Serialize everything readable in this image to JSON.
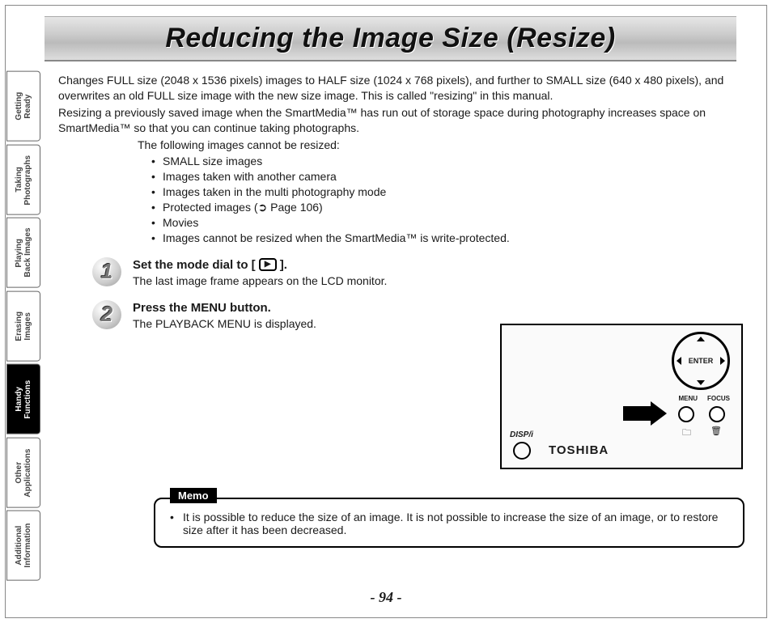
{
  "page": {
    "title": "Reducing the Image Size (Resize)",
    "number": "- 94 -"
  },
  "sidebar": {
    "items": [
      {
        "label": "Getting\nReady",
        "active": false
      },
      {
        "label": "Taking\nPhotographs",
        "active": false
      },
      {
        "label": "Playing\nBack Images",
        "active": false
      },
      {
        "label": "Erasing\nImages",
        "active": false
      },
      {
        "label": "Handy\nFunctions",
        "active": true
      },
      {
        "label": "Other\nApplications",
        "active": false
      },
      {
        "label": "Additional\nInformation",
        "active": false
      }
    ]
  },
  "intro": {
    "p1": "Changes FULL size (2048 x 1536 pixels) images to HALF size (1024 x 768 pixels), and further to SMALL size (640 x 480 pixels), and overwrites an old FULL size image with the new size image. This is called \"resizing\" in this manual.",
    "p2": "Resizing a previously saved image when the SmartMedia™ has run out of storage space during photography increases space on SmartMedia™ so that you can continue taking photographs.",
    "cannot_line": "The following images cannot be resized:",
    "bullets": [
      "SMALL size images",
      "Images taken with another camera",
      "Images taken in the multi photography mode",
      "Protected images (➲ Page 106)",
      "Movies",
      "Images cannot be resized when the SmartMedia™ is write-protected."
    ]
  },
  "steps": [
    {
      "num": "1",
      "title_pre": "Set the mode dial to [",
      "title_post": "].",
      "play_glyph": "▶",
      "sub": "The last image frame appears on the LCD monitor."
    },
    {
      "num": "2",
      "title": "Press the MENU button.",
      "sub": "The PLAYBACK MENU is displayed."
    }
  ],
  "camera": {
    "enter": "ENTER",
    "menu": "MENU",
    "focus": "FOCUS",
    "disp": "DISP/i",
    "brand": "TOSHIBA",
    "folder_glyph": "🗀",
    "trash_glyph": "🗑"
  },
  "memo": {
    "tag": "Memo",
    "items": [
      "It is possible to reduce the size of an image. It is not possible to increase the size of an image, or to restore size after it has been decreased."
    ]
  }
}
